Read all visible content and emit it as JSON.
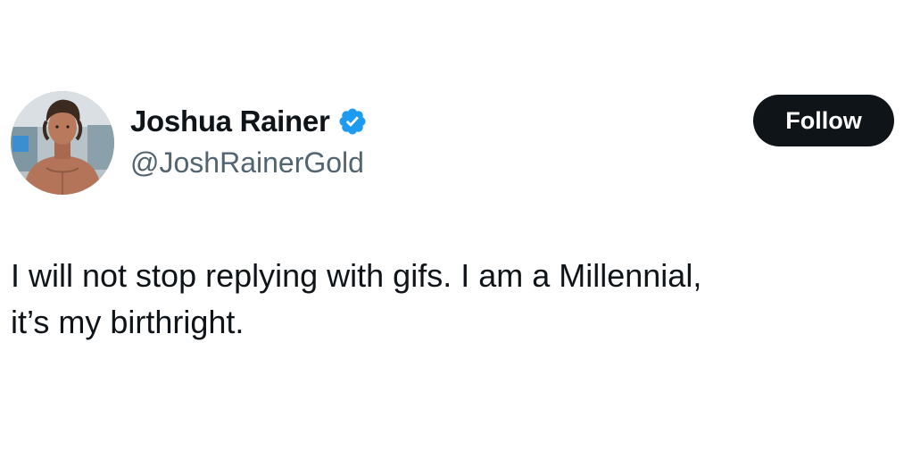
{
  "author": {
    "display_name": "Joshua Rainer",
    "handle": "@JoshRainerGold",
    "verified_icon": "verified-badge-icon",
    "avatar_description": "profile photo"
  },
  "follow_button": {
    "label": "Follow"
  },
  "tweet": {
    "lines": [
      "I will not stop replying with gifs. I am a Millennial,",
      "it’s my birthright."
    ]
  },
  "colors": {
    "text": "#0f1419",
    "secondary_text": "#536471",
    "verified_blue": "#1d9bf0",
    "button_bg": "#0f1419",
    "button_text": "#ffffff",
    "background": "#ffffff"
  }
}
